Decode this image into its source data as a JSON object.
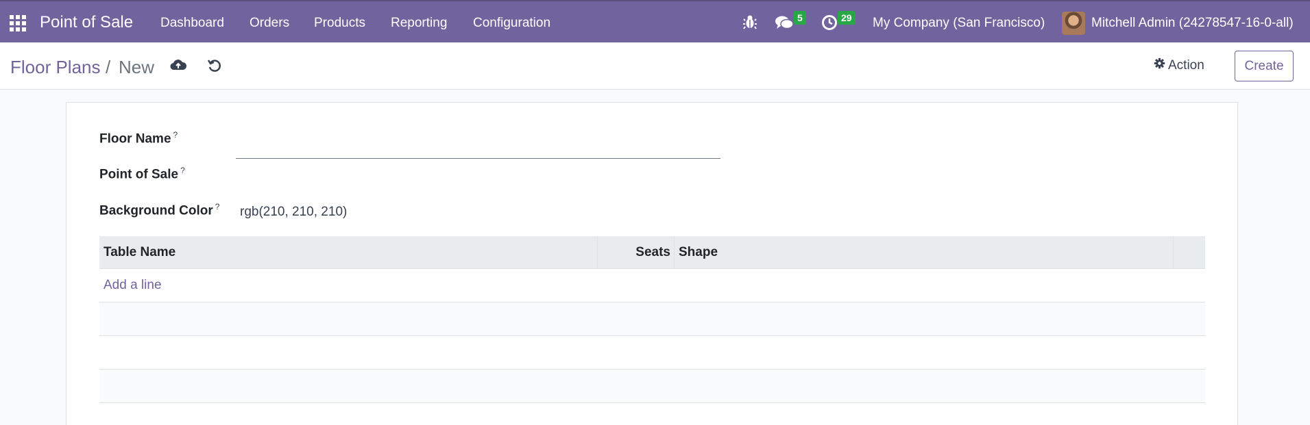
{
  "navbar": {
    "app_name": "Point of Sale",
    "menu": [
      "Dashboard",
      "Orders",
      "Products",
      "Reporting",
      "Configuration"
    ],
    "messages_count": "5",
    "activities_count": "29",
    "company": "My Company (San Francisco)",
    "user": "Mitchell Admin (24278547-16-0-all)"
  },
  "breadcrumb": {
    "parent": "Floor Plans",
    "separator": "/",
    "current": "New"
  },
  "control": {
    "action_label": "Action",
    "create_label": "Create"
  },
  "form": {
    "floor_name_label": "Floor Name",
    "floor_name_value": "",
    "pos_label": "Point of Sale",
    "pos_value": "",
    "bg_color_label": "Background Color",
    "bg_color_value": "rgb(210, 210, 210)",
    "help_mark": "?"
  },
  "tables": {
    "columns": [
      "Table Name",
      "Seats",
      "Shape"
    ],
    "add_line_label": "Add a line"
  },
  "colors": {
    "brand": "#71639e",
    "badge": "#28a745"
  },
  "icons": [
    "apps-grid-icon",
    "bug-icon",
    "chat-icon",
    "clock-icon",
    "cloud-upload-icon",
    "undo-icon",
    "gear-icon"
  ]
}
